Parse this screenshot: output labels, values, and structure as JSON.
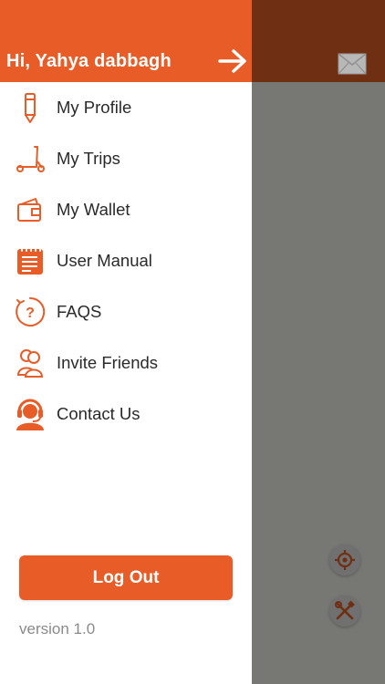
{
  "drawer": {
    "greeting": "Hi, Yahya dabbagh",
    "menu": [
      {
        "label": "My Profile",
        "icon": "pencil-icon"
      },
      {
        "label": "My Trips",
        "icon": "scooter-icon"
      },
      {
        "label": "My Wallet",
        "icon": "wallet-icon"
      },
      {
        "label": "User Manual",
        "icon": "notepad-icon"
      },
      {
        "label": "FAQS",
        "icon": "question-icon"
      },
      {
        "label": "Invite Friends",
        "icon": "friends-icon"
      },
      {
        "label": "Contact Us",
        "icon": "support-agent-icon"
      }
    ],
    "logout_label": "Log Out",
    "version": "version 1.0"
  },
  "colors": {
    "accent": "#e85d27",
    "overlay": "#777774",
    "overlay_header": "#6f2f12"
  }
}
